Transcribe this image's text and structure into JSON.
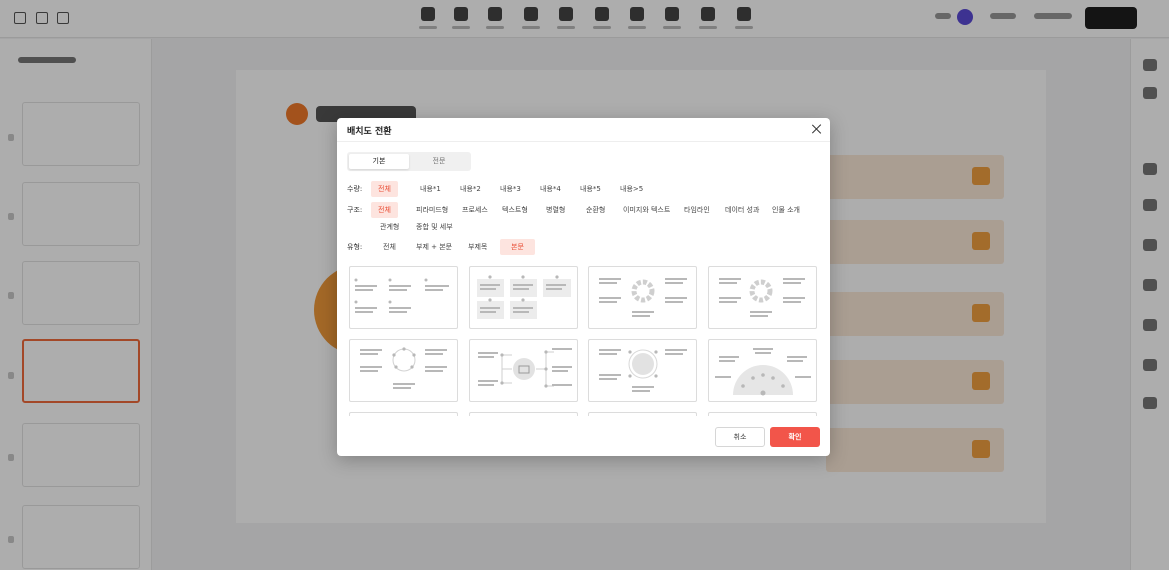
{
  "colors": {
    "accent": "#f2554a",
    "chip_active_bg": "#fde4df",
    "chip_active_text": "#e94e36",
    "app_accent": "#f06a3c"
  },
  "modal": {
    "title": "배치도 전환",
    "tabs": [
      {
        "label": "기본",
        "active": true
      },
      {
        "label": "전문",
        "active": false
      }
    ],
    "filters": {
      "quantity": {
        "label": "수량:",
        "options": [
          {
            "label": "전체",
            "active": true
          },
          {
            "label": "내용*1",
            "active": false
          },
          {
            "label": "내용*2",
            "active": false
          },
          {
            "label": "내용*3",
            "active": false
          },
          {
            "label": "내용*4",
            "active": false
          },
          {
            "label": "내용*5",
            "active": false
          },
          {
            "label": "내용>5",
            "active": false
          }
        ]
      },
      "structure": {
        "label": "구조:",
        "options": [
          {
            "label": "전체",
            "active": true
          },
          {
            "label": "피라미드형",
            "active": false
          },
          {
            "label": "프로세스",
            "active": false
          },
          {
            "label": "텍스트형",
            "active": false
          },
          {
            "label": "병렬형",
            "active": false
          },
          {
            "label": "순환형",
            "active": false
          },
          {
            "label": "이미지와 텍스트",
            "active": false
          },
          {
            "label": "타임라인",
            "active": false
          },
          {
            "label": "데이터 성과",
            "active": false
          },
          {
            "label": "인물 소개",
            "active": false
          },
          {
            "label": "관계형",
            "active": false
          },
          {
            "label": "종합 및 세부",
            "active": false
          }
        ]
      },
      "type": {
        "label": "유형:",
        "options": [
          {
            "label": "전체",
            "active": false
          },
          {
            "label": "부제 + 본문",
            "active": false
          },
          {
            "label": "부제목",
            "active": false
          },
          {
            "label": "본문",
            "active": true
          }
        ]
      }
    },
    "layouts": [
      {
        "kind": "dot-list"
      },
      {
        "kind": "box-grid"
      },
      {
        "kind": "ring"
      },
      {
        "kind": "ring"
      },
      {
        "kind": "orbit"
      },
      {
        "kind": "image-hub"
      },
      {
        "kind": "circle-center"
      },
      {
        "kind": "semicircle"
      }
    ],
    "buttons": {
      "cancel": "취소",
      "confirm": "확인"
    }
  }
}
